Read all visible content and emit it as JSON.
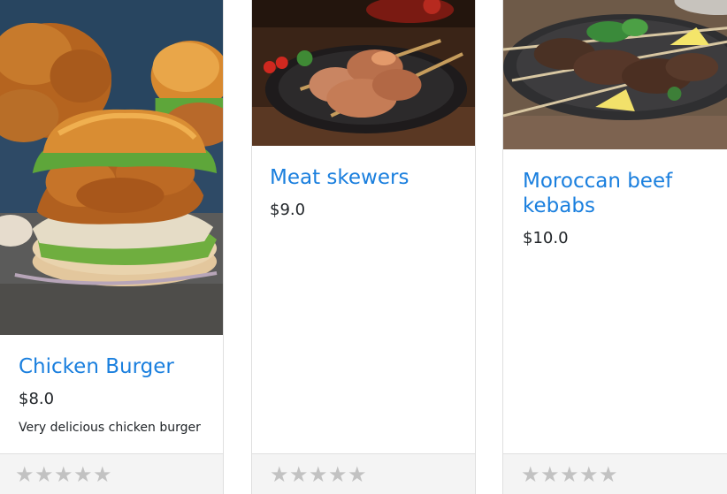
{
  "products": [
    {
      "name": "Chicken Burger",
      "price": "$8.0",
      "description": "Very delicious chicken burger",
      "image": "chicken-burger-photo",
      "rating_max": 5,
      "rating": 0
    },
    {
      "name": "Meat skewers",
      "price": "$9.0",
      "image": "meat-skewers-photo",
      "rating_max": 5,
      "rating": 0
    },
    {
      "name": "Moroccan beef kebabs",
      "price": "$10.0",
      "image": "beef-kebabs-photo",
      "rating_max": 5,
      "rating": 0
    }
  ],
  "colors": {
    "title": "#1a7fde",
    "text": "#212529",
    "star_empty": "#c2c2c2",
    "footer_bg": "#f4f4f4"
  },
  "icons": {
    "rating_star": "star-icon"
  }
}
